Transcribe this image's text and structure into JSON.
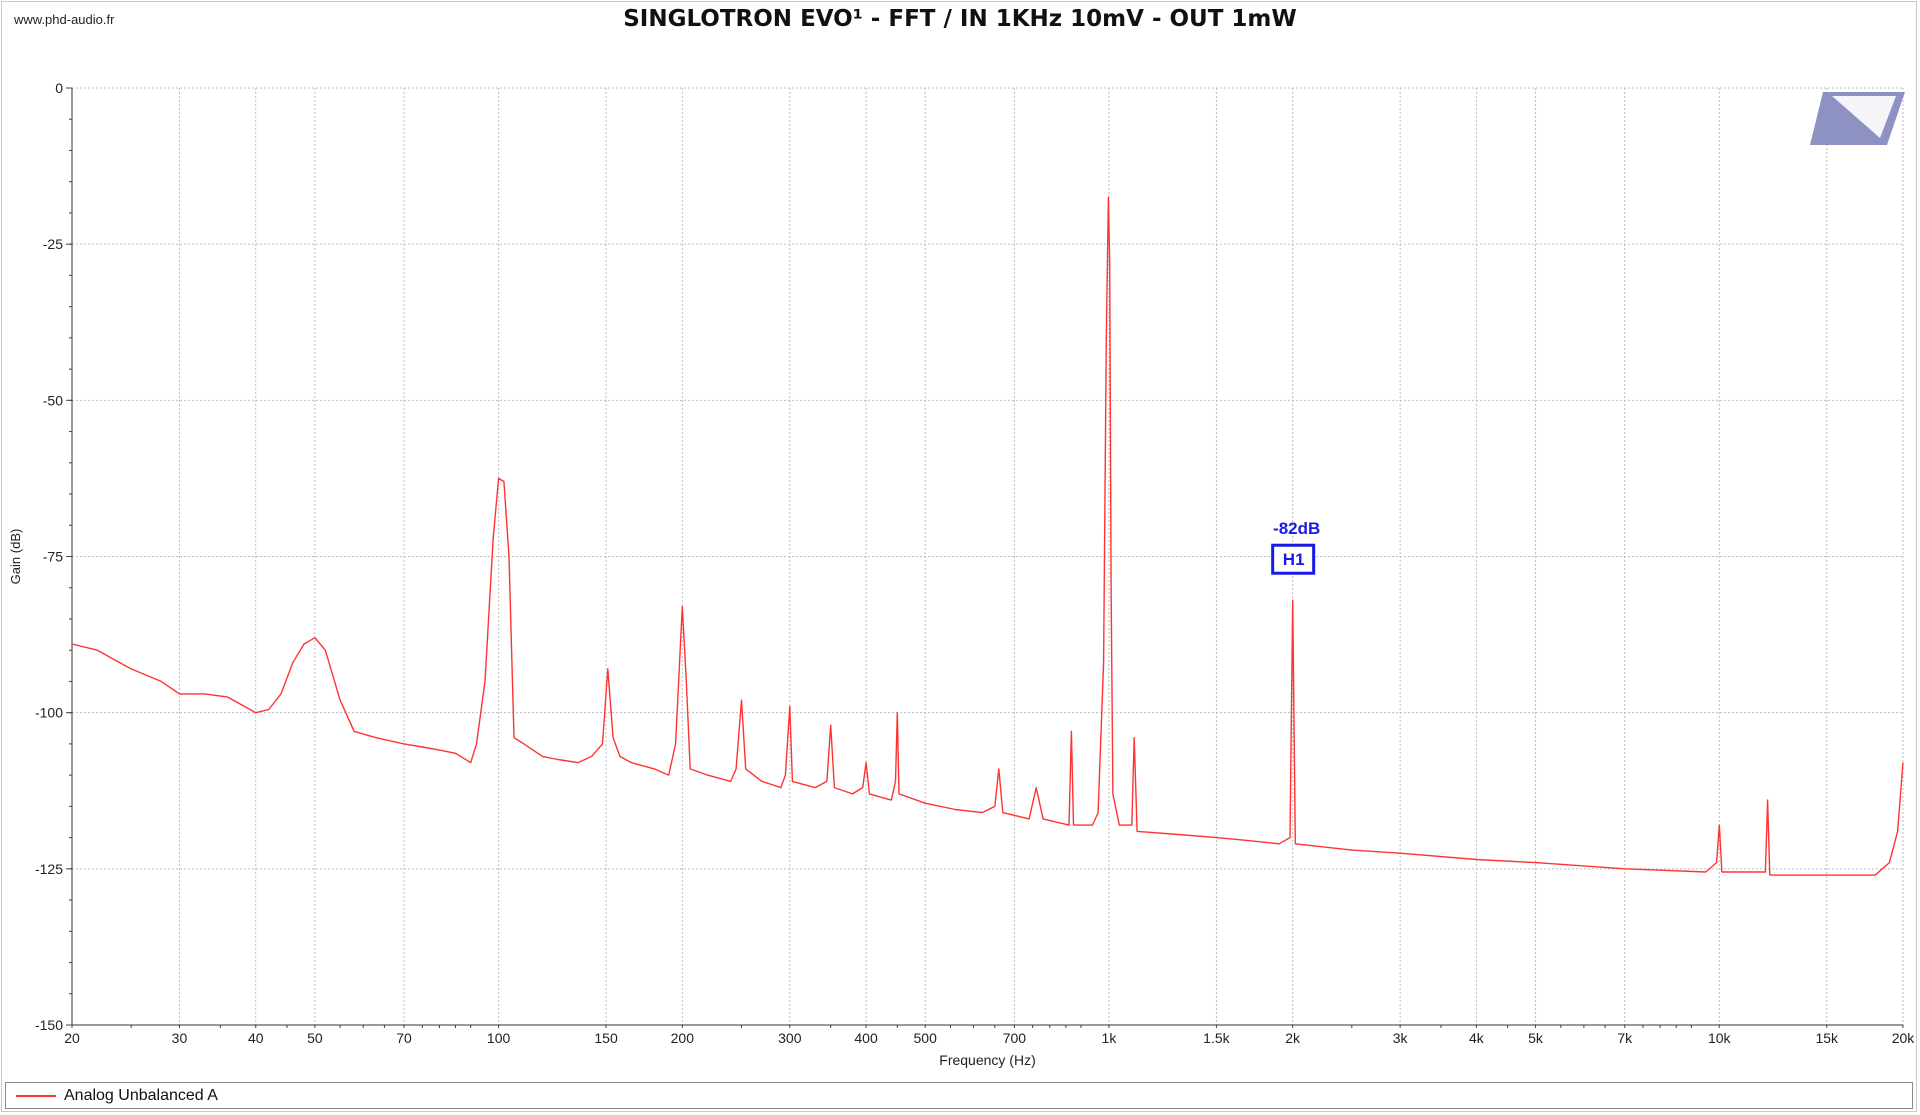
{
  "watermark": "www.phd-audio.fr",
  "title": "SINGLOTRON EVO¹ - FFT / IN 1KHz 10mV - OUT 1mW",
  "logo_icon": "phd-audio-logo-icon",
  "colors": {
    "series": "#ff3333",
    "grid": "#bdbdbd",
    "annotation": "#1a1ae6",
    "logo": "#7a7fb8"
  },
  "chart_data": {
    "type": "line",
    "title": "SINGLOTRON EVO¹ - FFT / IN 1KHz 10mV - OUT 1mW",
    "xlabel": "Frequency (Hz)",
    "ylabel": "Gain (dB)",
    "x_scale": "log",
    "xlim": [
      20,
      20000
    ],
    "ylim": [
      -150,
      0
    ],
    "grid": true,
    "legend_position": "bottom",
    "x_ticks": [
      {
        "value": 20,
        "label": "20"
      },
      {
        "value": 30,
        "label": "30"
      },
      {
        "value": 40,
        "label": "40"
      },
      {
        "value": 50,
        "label": "50"
      },
      {
        "value": 70,
        "label": "70"
      },
      {
        "value": 100,
        "label": "100"
      },
      {
        "value": 150,
        "label": "150"
      },
      {
        "value": 200,
        "label": "200"
      },
      {
        "value": 300,
        "label": "300"
      },
      {
        "value": 400,
        "label": "400"
      },
      {
        "value": 500,
        "label": "500"
      },
      {
        "value": 700,
        "label": "700"
      },
      {
        "value": 1000,
        "label": "1k"
      },
      {
        "value": 1500,
        "label": "1.5k"
      },
      {
        "value": 2000,
        "label": "2k"
      },
      {
        "value": 3000,
        "label": "3k"
      },
      {
        "value": 4000,
        "label": "4k"
      },
      {
        "value": 5000,
        "label": "5k"
      },
      {
        "value": 7000,
        "label": "7k"
      },
      {
        "value": 10000,
        "label": "10k"
      },
      {
        "value": 15000,
        "label": "15k"
      },
      {
        "value": 20000,
        "label": "20k"
      }
    ],
    "y_ticks": [
      {
        "value": 0,
        "label": "0"
      },
      {
        "value": -25,
        "label": "-25"
      },
      {
        "value": -50,
        "label": "-50"
      },
      {
        "value": -75,
        "label": "-75"
      },
      {
        "value": -100,
        "label": "-100"
      },
      {
        "value": -125,
        "label": "-125"
      },
      {
        "value": -150,
        "label": "-150"
      }
    ],
    "series": [
      {
        "name": "Analog Unbalanced A",
        "color": "#ff3333",
        "points": [
          [
            20,
            -89
          ],
          [
            22,
            -90
          ],
          [
            25,
            -93
          ],
          [
            28,
            -95
          ],
          [
            30,
            -97
          ],
          [
            33,
            -97
          ],
          [
            36,
            -97.5
          ],
          [
            40,
            -100
          ],
          [
            42,
            -99.5
          ],
          [
            44,
            -97
          ],
          [
            46,
            -92
          ],
          [
            48,
            -89
          ],
          [
            50,
            -88
          ],
          [
            52,
            -90
          ],
          [
            55,
            -98
          ],
          [
            58,
            -103
          ],
          [
            63,
            -104
          ],
          [
            70,
            -105
          ],
          [
            75,
            -105.5
          ],
          [
            80,
            -106
          ],
          [
            85,
            -106.5
          ],
          [
            90,
            -108
          ],
          [
            92,
            -105
          ],
          [
            95,
            -95
          ],
          [
            98,
            -72
          ],
          [
            100,
            -62.5
          ],
          [
            102,
            -63
          ],
          [
            104,
            -75
          ],
          [
            106,
            -104
          ],
          [
            110,
            -105
          ],
          [
            118,
            -107
          ],
          [
            125,
            -107.5
          ],
          [
            135,
            -108
          ],
          [
            142,
            -107
          ],
          [
            148,
            -105
          ],
          [
            151,
            -93
          ],
          [
            154,
            -104
          ],
          [
            158,
            -107
          ],
          [
            165,
            -108
          ],
          [
            180,
            -109
          ],
          [
            190,
            -110
          ],
          [
            195,
            -105
          ],
          [
            200,
            -83
          ],
          [
            203,
            -95
          ],
          [
            206,
            -109
          ],
          [
            220,
            -110
          ],
          [
            240,
            -111
          ],
          [
            245,
            -109
          ],
          [
            250,
            -98
          ],
          [
            254,
            -109
          ],
          [
            270,
            -111
          ],
          [
            290,
            -112
          ],
          [
            295,
            -110
          ],
          [
            300,
            -99
          ],
          [
            303,
            -111
          ],
          [
            330,
            -112
          ],
          [
            345,
            -111
          ],
          [
            350,
            -102
          ],
          [
            355,
            -112
          ],
          [
            380,
            -113
          ],
          [
            395,
            -112
          ],
          [
            400,
            -108
          ],
          [
            405,
            -113
          ],
          [
            440,
            -114
          ],
          [
            447,
            -111
          ],
          [
            450,
            -100
          ],
          [
            453,
            -113
          ],
          [
            500,
            -114.5
          ],
          [
            560,
            -115.5
          ],
          [
            620,
            -116
          ],
          [
            650,
            -115
          ],
          [
            660,
            -109
          ],
          [
            670,
            -116
          ],
          [
            740,
            -117
          ],
          [
            760,
            -112
          ],
          [
            780,
            -117
          ],
          [
            860,
            -118
          ],
          [
            868,
            -103
          ],
          [
            875,
            -118
          ],
          [
            940,
            -118
          ],
          [
            960,
            -116
          ],
          [
            980,
            -92
          ],
          [
            990,
            -40
          ],
          [
            998,
            -17.5
          ],
          [
            1003,
            -28
          ],
          [
            1008,
            -80
          ],
          [
            1015,
            -113
          ],
          [
            1040,
            -118
          ],
          [
            1090,
            -118
          ],
          [
            1100,
            -104
          ],
          [
            1112,
            -119
          ],
          [
            1300,
            -119.5
          ],
          [
            1500,
            -120
          ],
          [
            1700,
            -120.5
          ],
          [
            1900,
            -121
          ],
          [
            1980,
            -120
          ],
          [
            2000,
            -82
          ],
          [
            2020,
            -121
          ],
          [
            2500,
            -122
          ],
          [
            3000,
            -122.5
          ],
          [
            4000,
            -123.5
          ],
          [
            5000,
            -124
          ],
          [
            7000,
            -125
          ],
          [
            9500,
            -125.5
          ],
          [
            9900,
            -124
          ],
          [
            10000,
            -118
          ],
          [
            10100,
            -125.5
          ],
          [
            11900,
            -125.5
          ],
          [
            12000,
            -114
          ],
          [
            12100,
            -126
          ],
          [
            15000,
            -126
          ],
          [
            18000,
            -126
          ],
          [
            19000,
            -124
          ],
          [
            19600,
            -119
          ],
          [
            20000,
            -108
          ]
        ]
      }
    ],
    "annotations": [
      {
        "label": "H1",
        "value_label": "-82dB",
        "x": 2000,
        "y": -82
      }
    ]
  },
  "legend": {
    "items": [
      {
        "label": "Analog Unbalanced A"
      }
    ]
  }
}
